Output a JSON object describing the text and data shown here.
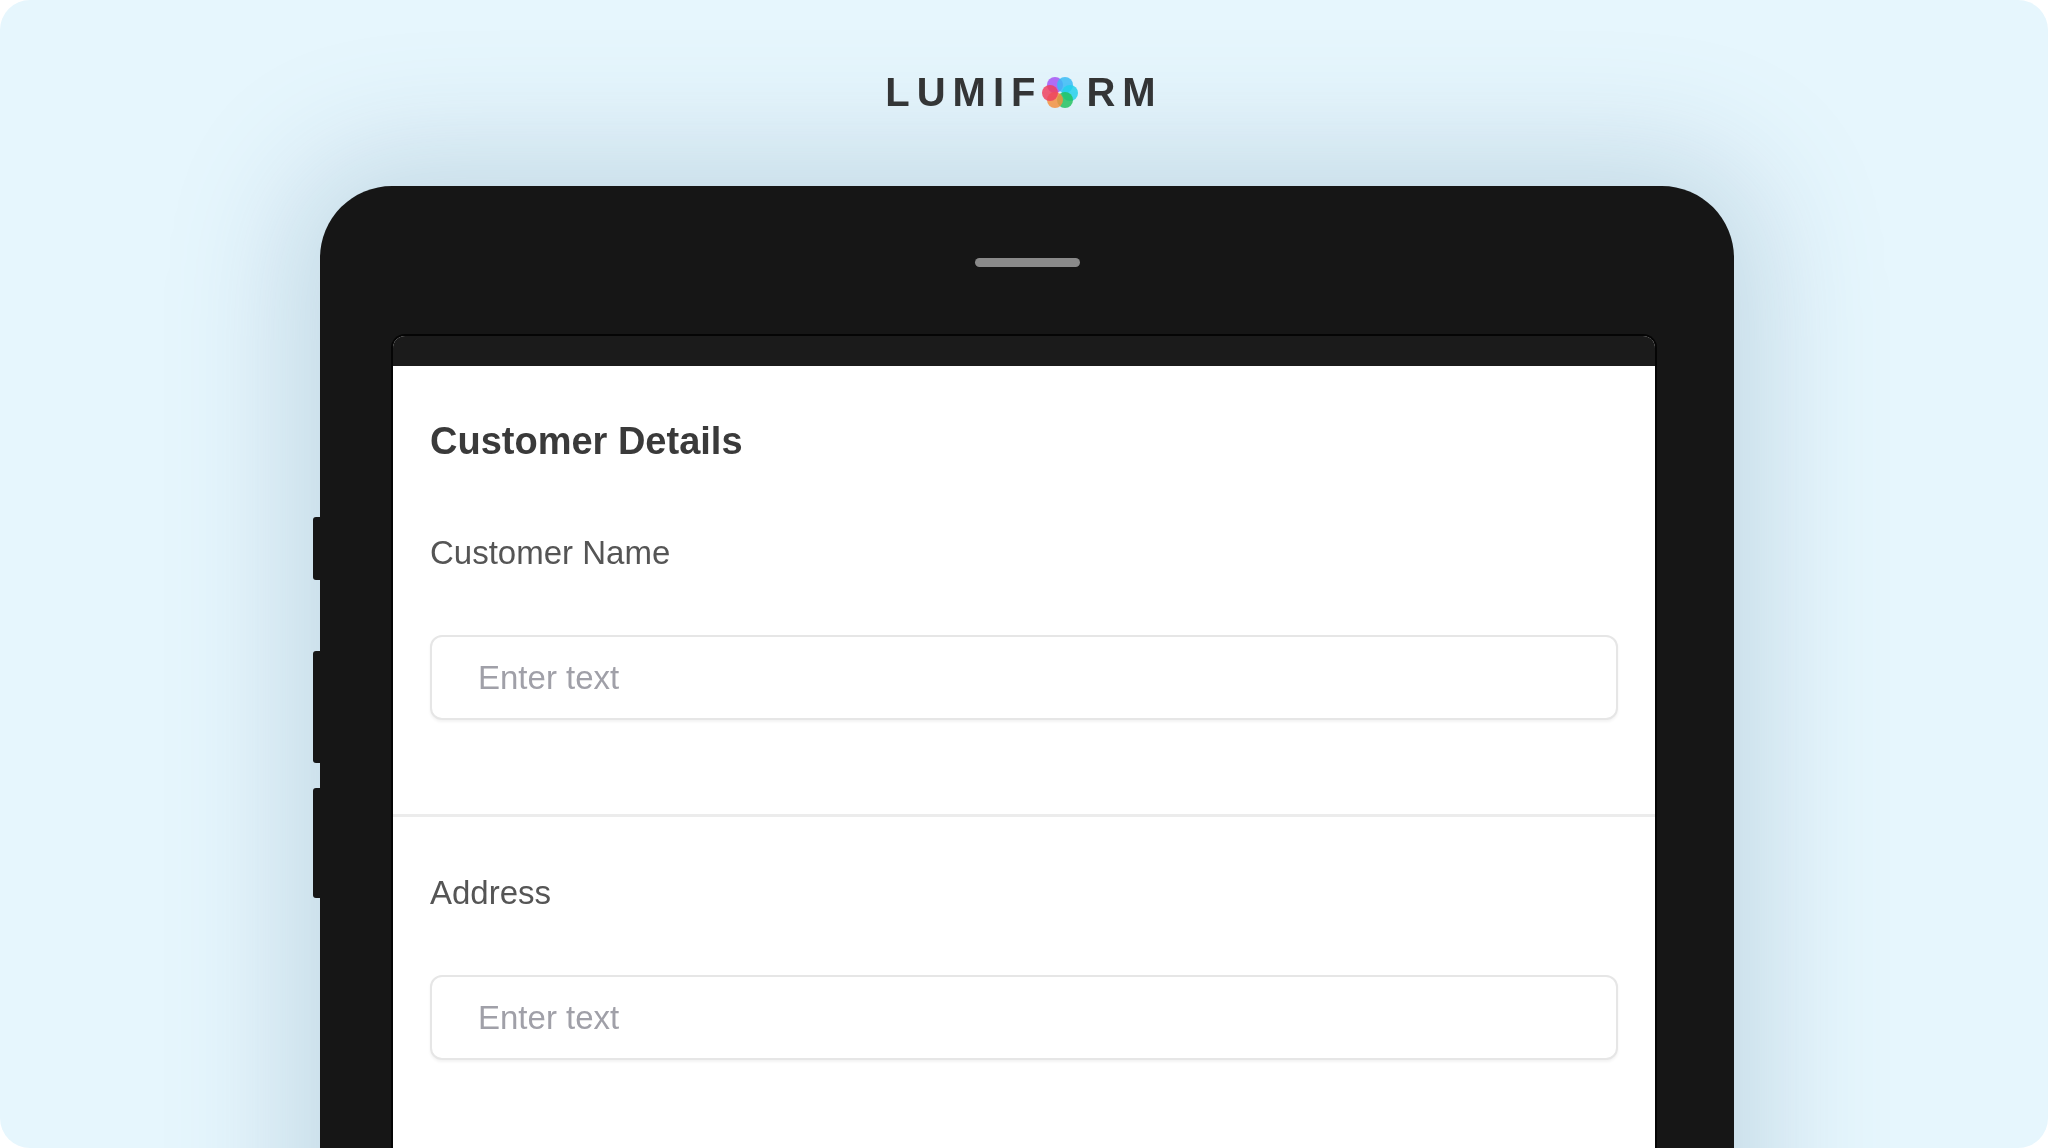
{
  "logo": {
    "text_before": "LUMIF",
    "text_after": "RM"
  },
  "form": {
    "title": "Customer Details",
    "sections": [
      {
        "label": "Customer Name",
        "placeholder": "Enter text"
      },
      {
        "label": "Address",
        "placeholder": "Enter text"
      }
    ]
  }
}
